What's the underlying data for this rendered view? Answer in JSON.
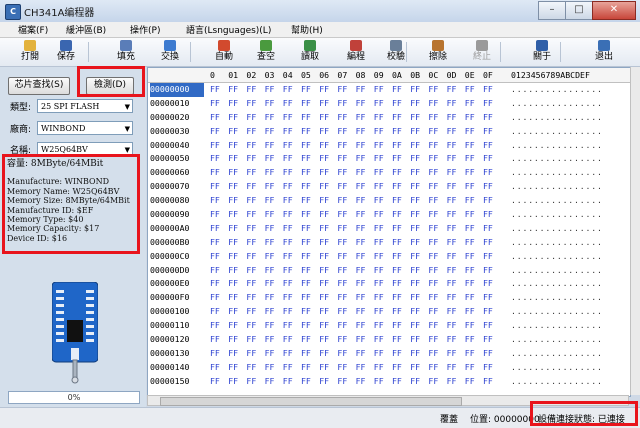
{
  "window": {
    "title": "CH341A编程器",
    "buttons": [
      "–",
      "□",
      "✕"
    ]
  },
  "menu": [
    "檔案(F)",
    "緩沖區(B)",
    "操作(P)",
    "語言(Lsnguages)(L)",
    "幫助(H)"
  ],
  "toolbar": [
    {
      "label": "打開",
      "icon": "open-folder-icon",
      "color": "#e3b23c"
    },
    {
      "label": "保存",
      "icon": "save-disk-icon",
      "color": "#3a66b0"
    },
    {
      "label": "填充",
      "icon": "fill-icon",
      "color": "#5a7db8"
    },
    {
      "label": "交換",
      "icon": "swap-arrows-icon",
      "color": "#3d7bd0"
    },
    {
      "label": "自動",
      "icon": "auto-icon",
      "color": "#d24a2e"
    },
    {
      "label": "查空",
      "icon": "check-blank-icon",
      "color": "#4a9a3e"
    },
    {
      "label": "讀取",
      "icon": "read-chip-icon",
      "color": "#3a8f46"
    },
    {
      "label": "編程",
      "icon": "program-chip-icon",
      "color": "#c0413a"
    },
    {
      "label": "校驗",
      "icon": "verify-icon",
      "color": "#6a7f99"
    },
    {
      "label": "擦除",
      "icon": "erase-icon",
      "color": "#b8742f"
    },
    {
      "label": "終止",
      "icon": "stop-icon",
      "color": "#9a9a9a",
      "disabled": true
    },
    {
      "label": "關于",
      "icon": "about-icon",
      "color": "#2f5fa8"
    },
    {
      "label": "退出",
      "icon": "exit-icon",
      "color": "#3a6fb5"
    }
  ],
  "left": {
    "find_chip_button": "芯片查找(S)",
    "detect_button": "檢測(D)",
    "type_label": "類型:",
    "type_value": "25 SPI FLASH",
    "vendor_label": "廠商:",
    "vendor_value": "WINBOND",
    "name_label": "名稱:",
    "name_value": "W25Q64BV",
    "capacity": "容量: 8MByte/64MBit",
    "info_lines": [
      "Manufacture: WINBOND",
      "Memory Name: W25Q64BV",
      "Memory Size: 8MByte/64MBit",
      "Manufacture ID: $EF",
      "Memory Type: $40",
      "Memory Capacity: $17",
      "Device ID: $16"
    ],
    "progress": "0%"
  },
  "hex": {
    "header_bytes": [
      "0",
      "01",
      "02",
      "03",
      "04",
      "05",
      "06",
      "07",
      "08",
      "09",
      "0A",
      "0B",
      "0C",
      "0D",
      "0E",
      "0F"
    ],
    "ascii_header": "0123456789ABCDEF",
    "byte_value": "FF",
    "ascii_fill": "................",
    "addresses": [
      "00000000",
      "00000010",
      "00000020",
      "00000030",
      "00000040",
      "00000050",
      "00000060",
      "00000070",
      "00000080",
      "00000090",
      "000000A0",
      "000000B0",
      "000000C0",
      "000000D0",
      "000000E0",
      "000000F0",
      "00000100",
      "00000110",
      "00000120",
      "00000130",
      "00000140",
      "00000150"
    ]
  },
  "status": {
    "mode": "覆蓋",
    "position_label": "位置: 00000000",
    "connection": "設備連接狀態: 已連接"
  }
}
